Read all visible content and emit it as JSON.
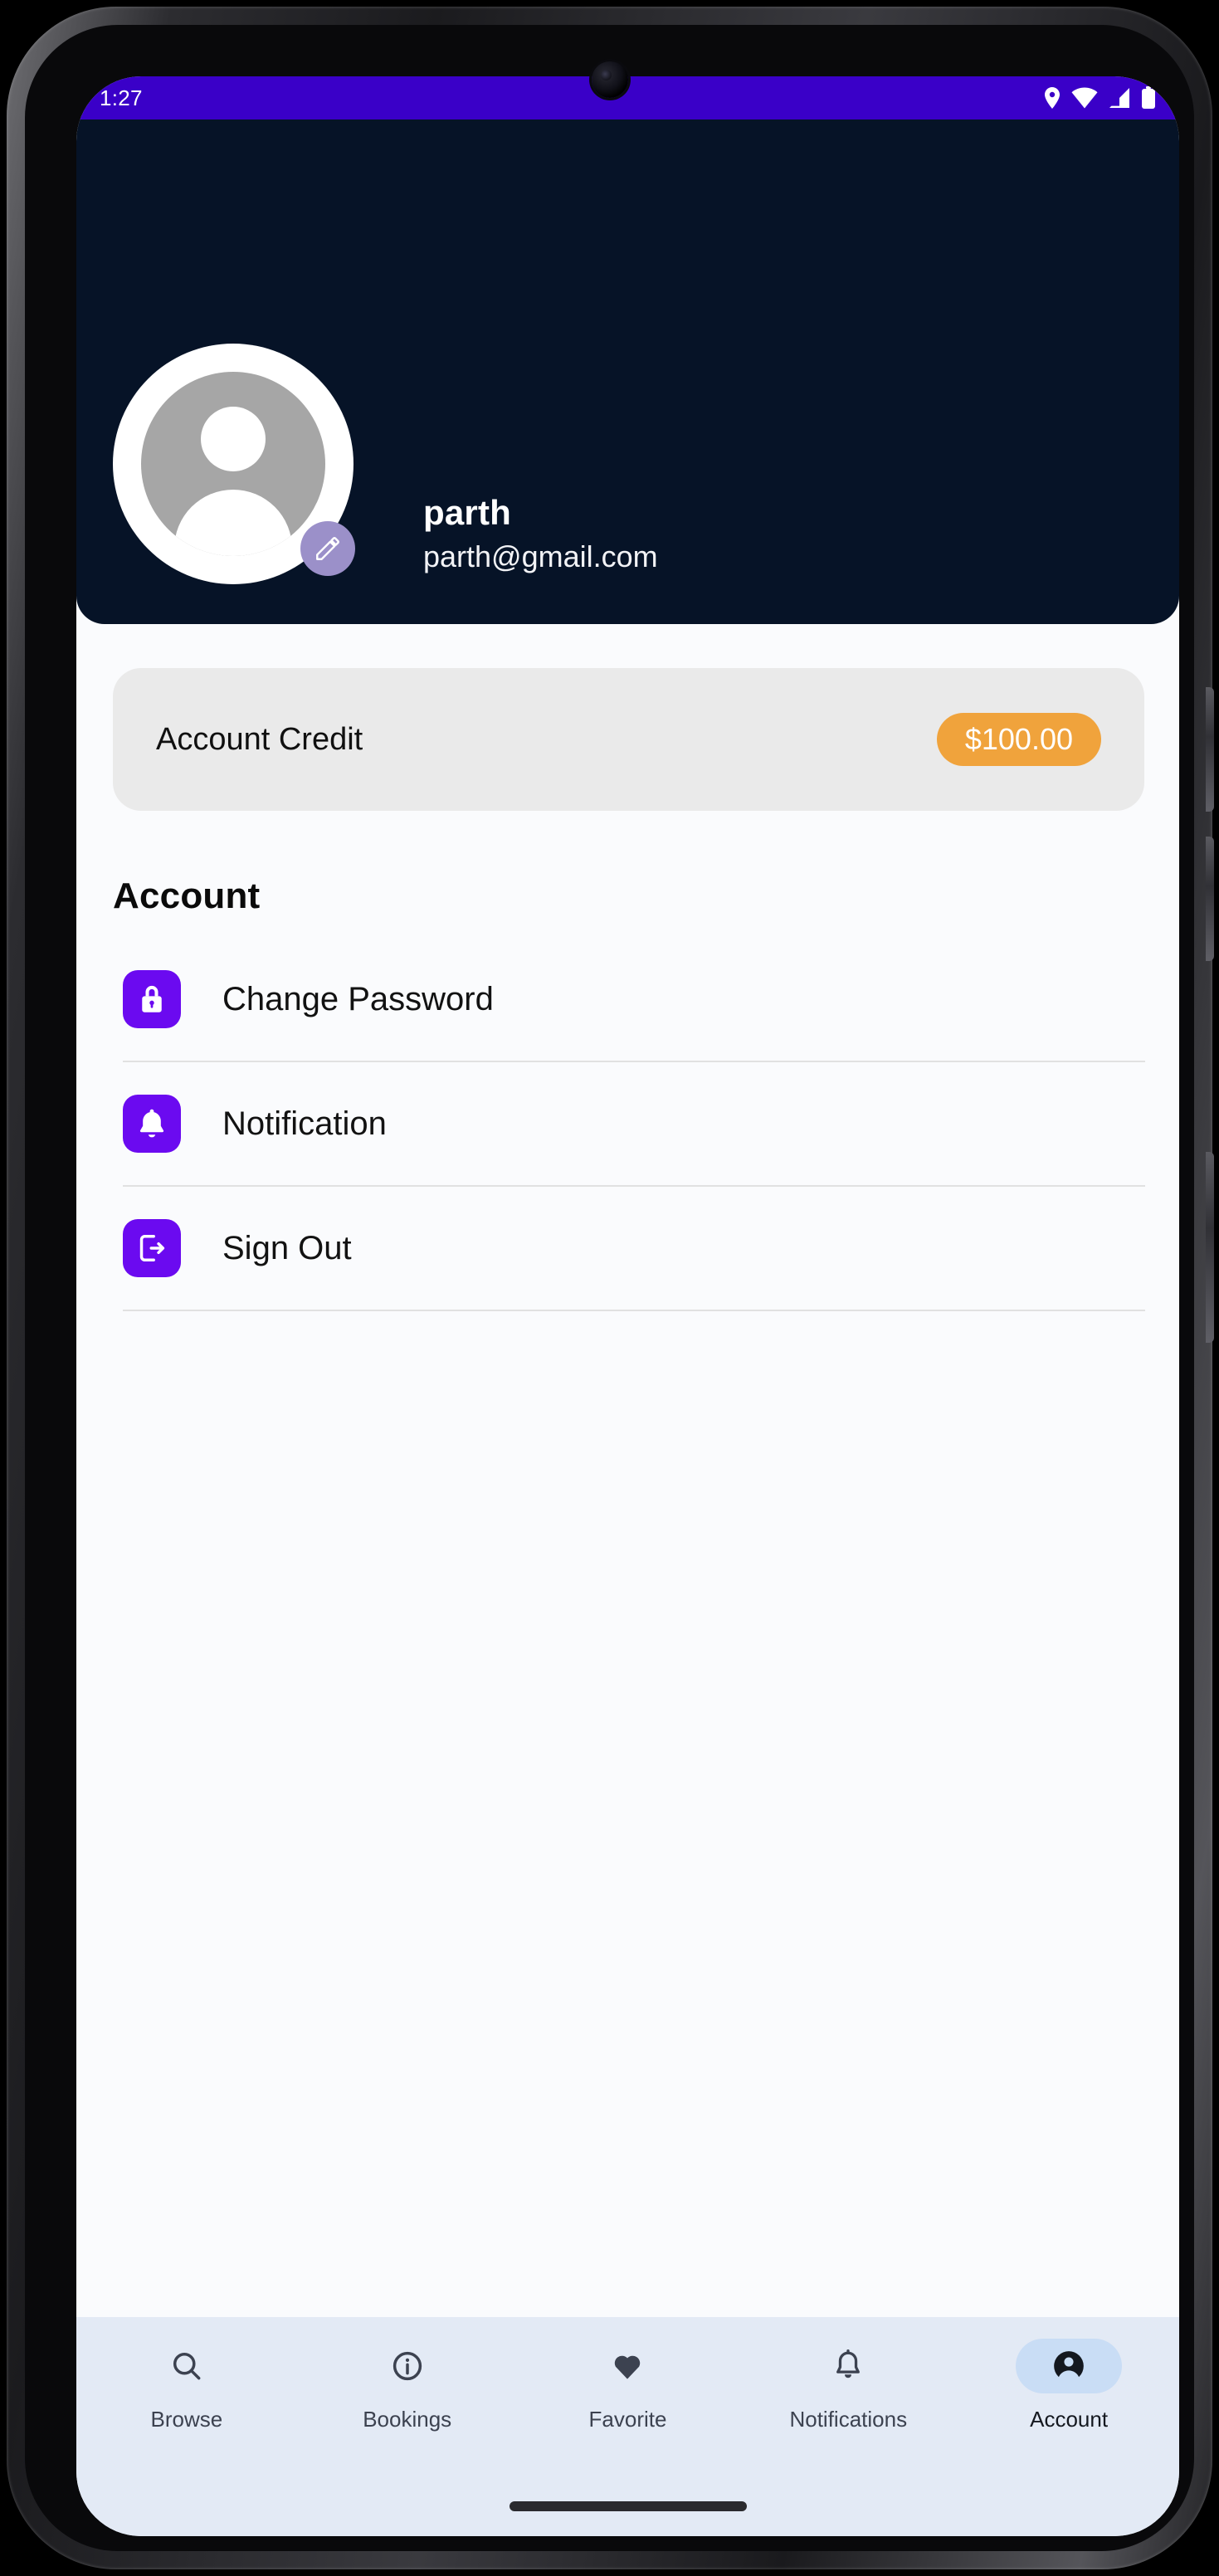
{
  "status_bar": {
    "time": "1:27",
    "icons": [
      "location-pin-icon",
      "wifi-icon",
      "cellular-signal-icon",
      "battery-icon"
    ],
    "background_color": "#3A00C8"
  },
  "profile": {
    "name": "parth",
    "email": "parth@gmail.com",
    "avatar_icon": "person-placeholder-icon",
    "edit_badge_icon": "pencil-edit-icon",
    "header_color": "#061327",
    "edit_badge_color": "#9B90C9"
  },
  "credit": {
    "label": "Account Credit",
    "amount": "$100.00",
    "badge_color": "#F0A33C",
    "card_color": "#EAEAEA"
  },
  "account_section": {
    "title": "Account",
    "accent_color": "#6B0AF0",
    "items": [
      {
        "label": "Change Password",
        "icon": "lock-icon"
      },
      {
        "label": "Notification",
        "icon": "bell-icon"
      },
      {
        "label": "Sign Out",
        "icon": "sign-out-icon"
      }
    ]
  },
  "bottom_nav": {
    "background_color": "#E3EAF5",
    "active_pill_color": "#C9DDF5",
    "active_index": 4,
    "items": [
      {
        "label": "Browse",
        "icon": "search-icon"
      },
      {
        "label": "Bookings",
        "icon": "info-circle-icon"
      },
      {
        "label": "Favorite",
        "icon": "heart-icon"
      },
      {
        "label": "Notifications",
        "icon": "bell-outline-icon"
      },
      {
        "label": "Account",
        "icon": "account-circle-icon"
      }
    ]
  }
}
